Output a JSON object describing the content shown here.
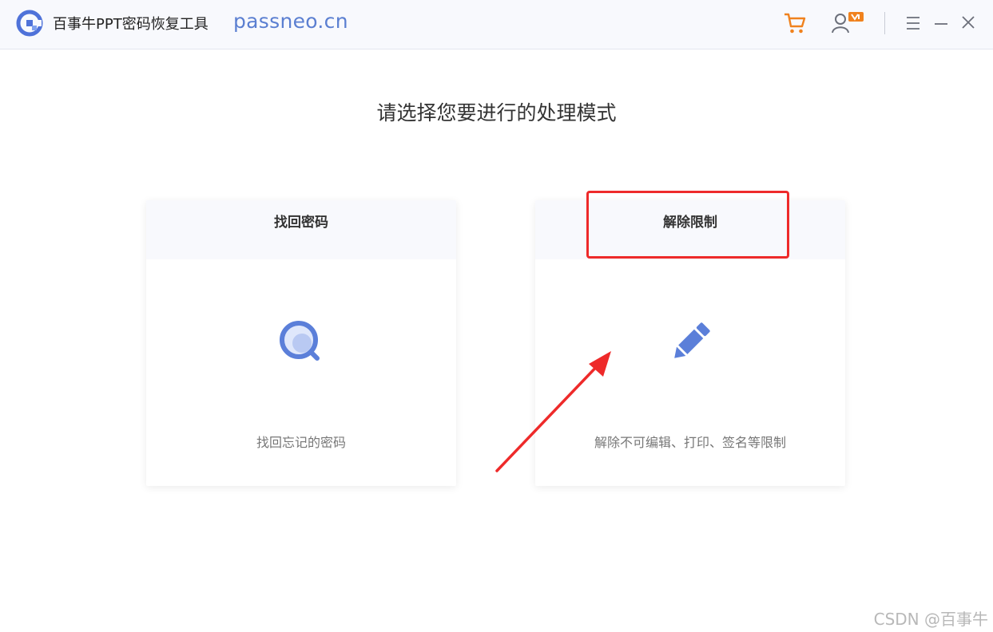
{
  "titlebar": {
    "app_name": "百事牛PPT密码恢复工具",
    "site": "passneo.cn",
    "icons": [
      "app-logo-icon",
      "cart-icon",
      "user-vip-icon",
      "menu-icon",
      "minimize-icon",
      "close-icon"
    ]
  },
  "main": {
    "heading": "请选择您要进行的处理模式",
    "cards": [
      {
        "title": "找回密码",
        "description": "找回忘记的密码",
        "icon": "magnifier-icon"
      },
      {
        "title": "解除限制",
        "description": "解除不可编辑、打印、签名等限制",
        "icon": "pencil-icon"
      }
    ]
  },
  "watermark": "CSDN @百事牛",
  "colors": {
    "accent_blue": "#5b7fd1",
    "cart_orange": "#f0821e",
    "highlight_red": "#ee2a2a",
    "titlebar_bg": "#f8f9fd"
  }
}
